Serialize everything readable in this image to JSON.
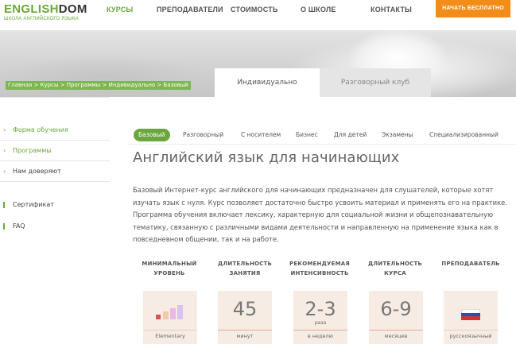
{
  "brand": {
    "logo_part1": "ENGLISH",
    "logo_part2": "DOM",
    "tagline": "ШКОЛА АНГЛИЙСКОГО ЯЗЫКА",
    "accent_color": "#6aa63b",
    "cta_color": "#f28d1a"
  },
  "nav": {
    "items": [
      {
        "label": "КУРСЫ",
        "active": true
      },
      {
        "label": "ПРЕПОДАВАТЕЛИ",
        "active": false
      },
      {
        "label": "СТОИМОСТЬ",
        "active": false
      },
      {
        "label": "О ШКОЛЕ",
        "active": false
      },
      {
        "label": "КОНТАКТЫ",
        "active": false
      }
    ],
    "cta_label": "НАЧАТЬ БЕСПЛАТНО"
  },
  "breadcrumb": "Главная > Курсы > Программы > Индивидуально > Базовый",
  "tabs": [
    {
      "label": "Индивидуально",
      "active": true
    },
    {
      "label": "Разговорный клуб",
      "active": false
    }
  ],
  "sidebar": {
    "items": [
      {
        "label": "Форма обучения",
        "icon": "chevron-right-icon"
      },
      {
        "label": "Программы",
        "icon": "chevron-right-icon"
      },
      {
        "label": "Нам доверяют",
        "icon": "chevron-right-icon"
      },
      {
        "label": "Сертификат",
        "icon": "bar-icon"
      },
      {
        "label": "FAQ",
        "icon": "bar-icon"
      }
    ]
  },
  "subtabs": [
    {
      "label": "Базовый",
      "active": true
    },
    {
      "label": "Разговорный",
      "active": false
    },
    {
      "label": "С носителем",
      "active": false
    },
    {
      "label": "Бизнес",
      "active": false
    },
    {
      "label": "Для детей",
      "active": false
    },
    {
      "label": "Экзамены",
      "active": false
    },
    {
      "label": "Специализированный",
      "active": false
    }
  ],
  "main": {
    "title": "Английский язык для начинающих",
    "description": "Базовый Интернет-курс английского для начинающих предназначен для слушателей, которые хотят изучать язык с нуля. Курс позволяет достаточно быстро усвоить материал и применять его на практике. Программа обучения включает лексику, характерную для социальной жизни и общепознавательную тематику, связанную с различными видами деятельности и направленную на применение языка как в повседневном общении, так и на работе."
  },
  "stats": [
    {
      "label": "МИНИМАЛЬНЫЙ УРОВЕНЬ",
      "value": "",
      "unit": "",
      "footer": "Elementary",
      "type": "level",
      "level": 1,
      "levels_total": 4,
      "underline": "#e0d0c4"
    },
    {
      "label": "ДЛИТЕЛЬНОСТЬ ЗАНЯТИЯ",
      "value": "45",
      "unit": "",
      "footer": "минут",
      "type": "number",
      "underline": "#e7a8a0"
    },
    {
      "label": "РЕКОМЕНДУЕМАЯ ИНТЕНСИВНОСТЬ",
      "value": "2-3",
      "unit": "раза",
      "footer": "в неделю",
      "type": "number",
      "underline": "#e7a8a0"
    },
    {
      "label": "ДЛИТЕЛЬНОСТЬ КУРСА",
      "value": "6-9",
      "unit": "",
      "footer": "месяцев",
      "type": "number",
      "underline": "#e7a8a0"
    },
    {
      "label": "ПРЕПОДАВАТЕЛЬ",
      "value": "",
      "unit": "",
      "footer": "русскоязычный",
      "type": "flag",
      "flag_icon": "russian-flag-icon",
      "underline": "#e0d0c4"
    }
  ]
}
